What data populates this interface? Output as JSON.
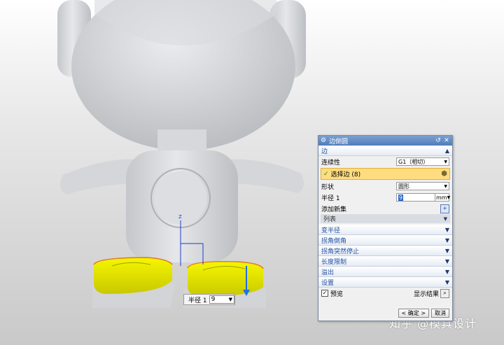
{
  "viewport": {
    "radius_label": "半径 1",
    "radius_value": "9",
    "axis_label": "Z",
    "watermark": "知乎 @模具设计"
  },
  "dialog": {
    "title": "边倒圆",
    "edge_section": {
      "title": "边",
      "continuity_label": "连续性",
      "continuity_value": "G1（相切）",
      "select_label": "选择边 (8)",
      "shape_label": "形状",
      "shape_value": "圆形",
      "radius_label": "半径 1",
      "radius_value": "9",
      "radius_unit": "mm",
      "add_set_label": "添加新集",
      "list_label": "列表"
    },
    "collapsed_sections": [
      "变半径",
      "拐角倒角",
      "拐角突然停止",
      "长度限制",
      "溢出",
      "设置"
    ],
    "preview_label": "预览",
    "show_result_label": "显示结果",
    "ok_label": "< 确定 >",
    "cancel_label": "取消"
  },
  "colors": {
    "highlight_yellow": "#f3f300",
    "edge_orange": "#e07820",
    "title_blue": "#4f7cbd",
    "select_row": "#ffdc80"
  }
}
